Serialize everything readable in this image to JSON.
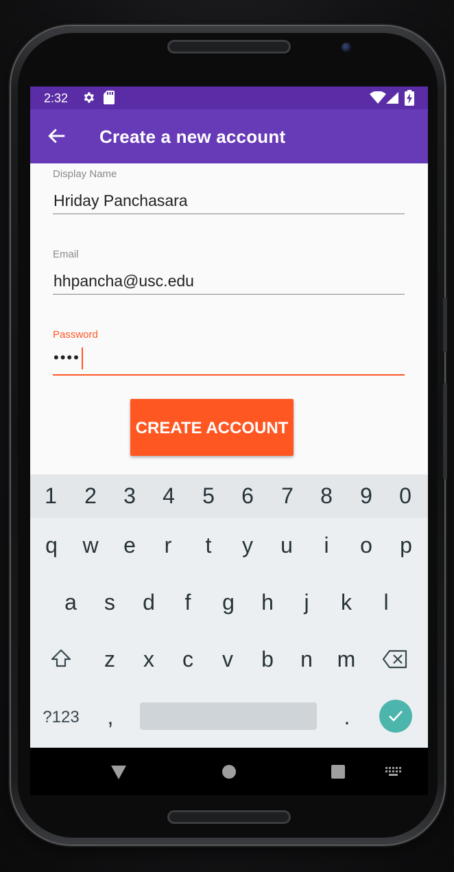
{
  "status_bar": {
    "time": "2:32",
    "icons": [
      "settings-icon",
      "sd-card-icon",
      "wifi-icon",
      "cell-signal-icon",
      "battery-charging-icon"
    ]
  },
  "app_bar": {
    "title": "Create a new account",
    "back_icon": "arrow-back-icon"
  },
  "form": {
    "display_name": {
      "label": "Display Name",
      "value": "Hriday Panchasara"
    },
    "email": {
      "label": "Email",
      "value": "hhpancha@usc.edu"
    },
    "password": {
      "label": "Password",
      "value": "••••"
    }
  },
  "create_button_label": "CREATE ACCOUNT",
  "keyboard": {
    "number_row": [
      "1",
      "2",
      "3",
      "4",
      "5",
      "6",
      "7",
      "8",
      "9",
      "0"
    ],
    "row1": [
      "q",
      "w",
      "e",
      "r",
      "t",
      "y",
      "u",
      "i",
      "o",
      "p"
    ],
    "row2": [
      "a",
      "s",
      "d",
      "f",
      "g",
      "h",
      "j",
      "k",
      "l"
    ],
    "row3": [
      "z",
      "x",
      "c",
      "v",
      "b",
      "n",
      "m"
    ],
    "symbols_label": "?123",
    "comma": ",",
    "period": ".",
    "shift_icon": "shift-icon",
    "backspace_icon": "backspace-icon",
    "enter_icon": "checkmark-icon"
  },
  "nav_bar": {
    "icons": [
      "back-triangle-icon",
      "home-circle-icon",
      "recents-square-icon",
      "keyboard-switch-icon"
    ]
  },
  "colors": {
    "status_bar": "#5a2da6",
    "app_bar": "#673ab7",
    "accent": "#ff5722",
    "enter_key": "#4db6ac",
    "keyboard_bg": "#eceff1"
  }
}
